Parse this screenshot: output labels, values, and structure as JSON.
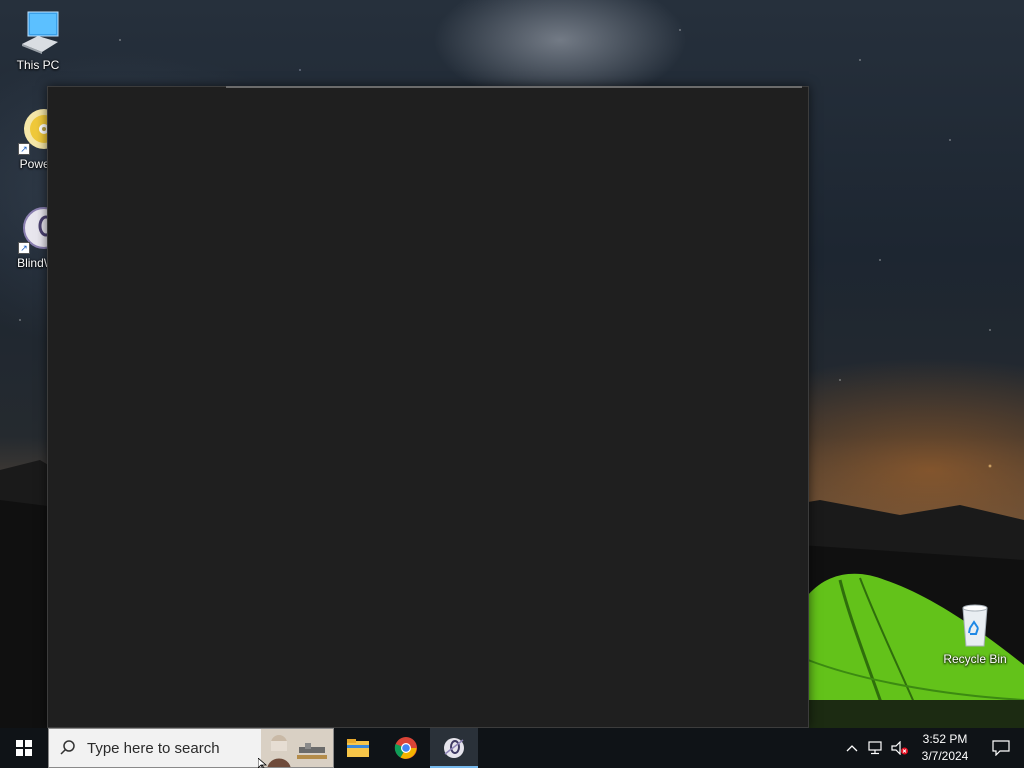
{
  "desktop": {
    "icons": [
      {
        "label": "This PC",
        "icon": "computer-icon"
      },
      {
        "label": "Powerl",
        "icon": "powerdvd-disc-icon"
      },
      {
        "label": "BlindWr",
        "icon": "blindwrite-disc-icon"
      },
      {
        "label": "Recycle Bin",
        "icon": "recycle-bin-icon"
      }
    ]
  },
  "window": {
    "state": "blank-loading",
    "background": "#1f1f1f"
  },
  "taskbar": {
    "start_icon": "windows-logo-icon",
    "search_placeholder": "Type here to search",
    "pinned": [
      {
        "name": "File Explorer",
        "icon": "folder-icon"
      },
      {
        "name": "Google Chrome",
        "icon": "chrome-icon"
      },
      {
        "name": "BlindWrite",
        "icon": "blindwrite-icon",
        "active": true
      }
    ],
    "tray": {
      "chevron_icon": "chevron-up-icon",
      "network_icon": "network-icon",
      "volume_icon": "volume-muted-icon",
      "time": "3:52 PM",
      "date": "3/7/2024",
      "notification_icon": "action-center-icon"
    }
  },
  "colors": {
    "taskbar_bg": "#0f1317",
    "accent": "#76b9ed"
  }
}
